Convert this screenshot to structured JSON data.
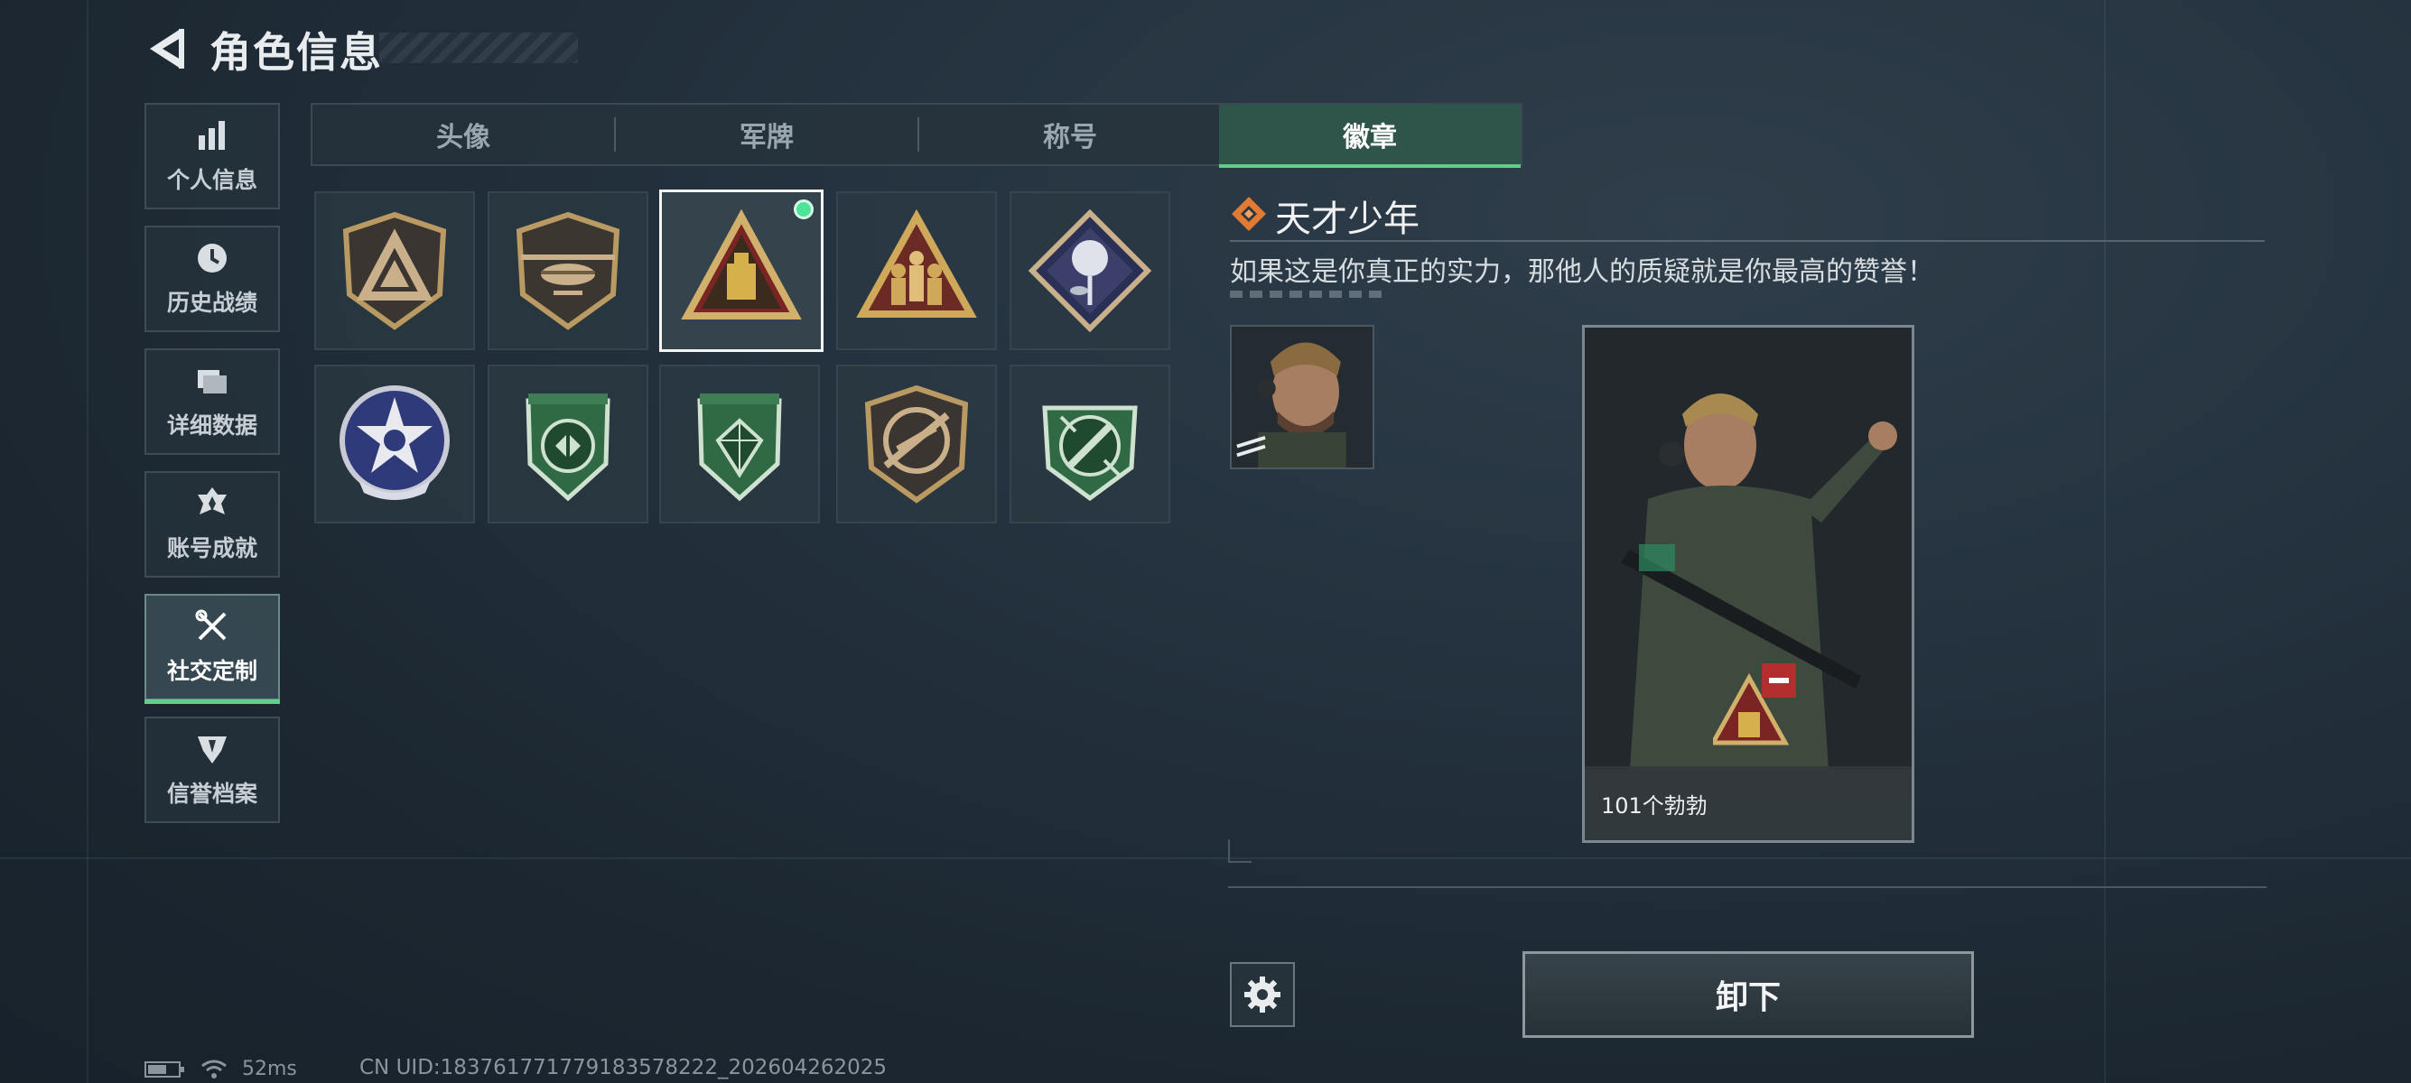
{
  "header": {
    "title": "角色信息"
  },
  "nav": {
    "items": [
      {
        "label": "个人信息",
        "icon": "bar-chart-icon"
      },
      {
        "label": "历史战绩",
        "icon": "clock-icon"
      },
      {
        "label": "详细数据",
        "icon": "folder-icon"
      },
      {
        "label": "账号成就",
        "icon": "medal-icon"
      },
      {
        "label": "社交定制",
        "icon": "tools-icon"
      },
      {
        "label": "信誉档案",
        "icon": "shield-icon"
      }
    ],
    "active_index": 4
  },
  "tabs": {
    "items": [
      {
        "label": "头像"
      },
      {
        "label": "军牌"
      },
      {
        "label": "称号"
      },
      {
        "label": "徽章"
      }
    ],
    "active_index": 3
  },
  "badges": {
    "items": [
      {
        "icon": "tan-shield-triangle-icon"
      },
      {
        "icon": "helicopter-shield-icon"
      },
      {
        "icon": "red-triangle-flag-icon",
        "selected": true,
        "equipped": true
      },
      {
        "icon": "soldiers-triangle-icon"
      },
      {
        "icon": "rose-diamond-icon"
      },
      {
        "icon": "star-skull-circle-icon"
      },
      {
        "icon": "green-shield-arrows-icon"
      },
      {
        "icon": "green-shield-gem-icon"
      },
      {
        "icon": "rifle-cross-circle-icon"
      },
      {
        "icon": "green-shield-knife-icon"
      }
    ]
  },
  "detail": {
    "name": "天才少年",
    "description": "如果这是你真正的实力，那他人的质疑就是你最高的赞誉！",
    "card_caption": "101个勃勃",
    "unequip_label": "卸下"
  },
  "status": {
    "ping": "52ms",
    "uid": "CN UID:18376177177918357822​2_202604262025"
  },
  "colors": {
    "accent_green": "#5fd08a",
    "tab_active_bg": "#2f5449",
    "detail_icon": "#e07a34"
  }
}
